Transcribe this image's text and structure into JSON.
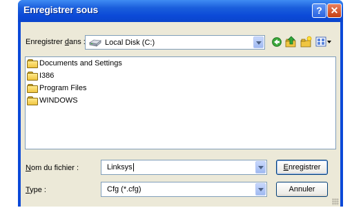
{
  "window": {
    "title": "Enregistrer sous",
    "help_label": "?",
    "close_label": "✕"
  },
  "save_in": {
    "label_pre": "Enregistrer ",
    "label_accel": "d",
    "label_post": "ans :",
    "value": "Local Disk (C:)"
  },
  "toolbar": {
    "icons": [
      "back-icon",
      "up-folder-icon",
      "new-folder-icon",
      "views-menu-icon"
    ]
  },
  "file_list": {
    "items": [
      {
        "label": "Documents and Settings",
        "icon": "folder-icon"
      },
      {
        "label": "I386",
        "icon": "folder-icon"
      },
      {
        "label": "Program Files",
        "icon": "folder-icon"
      },
      {
        "label": "WINDOWS",
        "icon": "folder-icon"
      }
    ]
  },
  "filename": {
    "label_accel": "N",
    "label_post": "om du fichier :",
    "value": "Linksys"
  },
  "filetype": {
    "label_accel": "T",
    "label_post": "ype :",
    "value": "Cfg (*.cfg)"
  },
  "buttons": {
    "save_accel": "E",
    "save_post": "nregistrer",
    "cancel": "Annuler"
  },
  "colors": {
    "titlebar": "#0b49d8",
    "dialog_bg": "#ece9d8",
    "close_button": "#c63f12"
  }
}
